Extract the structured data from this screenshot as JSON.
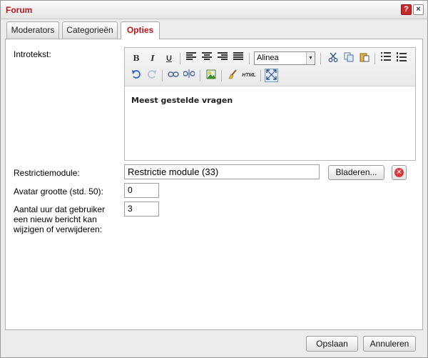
{
  "window": {
    "title": "Forum",
    "help_label": "?",
    "close_label": "×"
  },
  "tabs": [
    {
      "label": "Moderators"
    },
    {
      "label": "Categorieën"
    },
    {
      "label": "Opties"
    }
  ],
  "form": {
    "intro_label": "Introtekst:",
    "restriction_label": "Restrictiemodule:",
    "restriction_value": "Restrictie module (33)",
    "browse_label": "Bladeren...",
    "avatar_label": "Avatar grootte (std. 50):",
    "avatar_value": "0",
    "hours_label": "Aantal uur dat gebruiker een nieuw bericht kan wijzigen of verwijderen:",
    "hours_value": "3"
  },
  "editor": {
    "bold": "B",
    "italic": "I",
    "underline": "U",
    "format_value": "Alinea",
    "html_label": "HTML",
    "content": "Meest gestelde vragen"
  },
  "footer": {
    "save_label": "Opslaan",
    "cancel_label": "Annuleren"
  }
}
